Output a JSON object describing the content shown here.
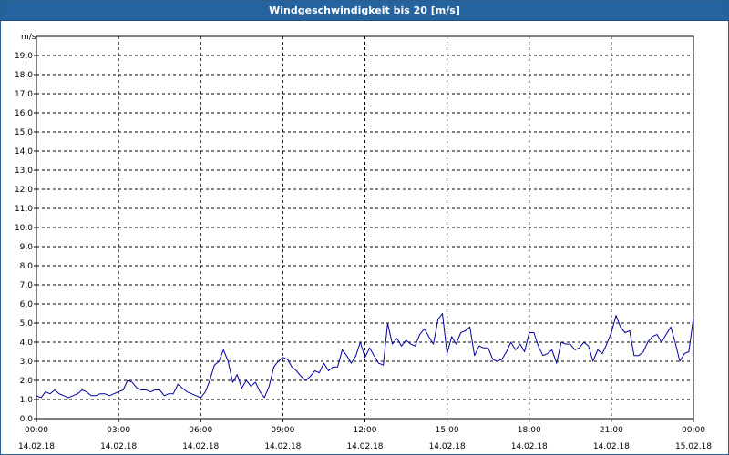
{
  "window": {
    "title": "Windgeschwindigkeit bis 20 [m/s]"
  },
  "colors": {
    "titlebar": "#2563a0",
    "series": "#0000a0",
    "grid": "#000000"
  },
  "chart_data": {
    "type": "line",
    "title": "Windgeschwindigkeit bis 20 [m/s]",
    "ylabel": "m/s",
    "ylim": [
      0,
      20
    ],
    "xlim_hours": [
      0,
      24
    ],
    "grid": true,
    "y_ticks": [
      "0,0",
      "1,0",
      "2,0",
      "3,0",
      "4,0",
      "5,0",
      "6,0",
      "7,0",
      "8,0",
      "9,0",
      "10,0",
      "11,0",
      "12,0",
      "13,0",
      "14,0",
      "15,0",
      "16,0",
      "17,0",
      "18,0",
      "19,0"
    ],
    "x_ticks": [
      {
        "time": "00:00",
        "date": "14.02.18"
      },
      {
        "time": "03:00",
        "date": "14.02.18"
      },
      {
        "time": "06:00",
        "date": "14.02.18"
      },
      {
        "time": "09:00",
        "date": "14.02.18"
      },
      {
        "time": "12:00",
        "date": "14.02.18"
      },
      {
        "time": "15:00",
        "date": "14.02.18"
      },
      {
        "time": "18:00",
        "date": "14.02.18"
      },
      {
        "time": "21:00",
        "date": "14.02.18"
      },
      {
        "time": "00:00",
        "date": "15.02.18"
      }
    ],
    "series": [
      {
        "x_hours": [
          0,
          0.17,
          0.33,
          0.5,
          0.67,
          0.83,
          1,
          1.17,
          1.33,
          1.5,
          1.67,
          1.83,
          2,
          2.17,
          2.33,
          2.5,
          2.67,
          2.83,
          3,
          3.17,
          3.33,
          3.5,
          3.67,
          3.83,
          4,
          4.17,
          4.33,
          4.5,
          4.67,
          4.83,
          5,
          5.17,
          5.33,
          5.5,
          5.67,
          5.83,
          6,
          6.17,
          6.33,
          6.5,
          6.67,
          6.83,
          7,
          7.17,
          7.33,
          7.5,
          7.67,
          7.83,
          8,
          8.17,
          8.33,
          8.5,
          8.67,
          8.83,
          9,
          9.17,
          9.33,
          9.5,
          9.67,
          9.83,
          10,
          10.17,
          10.33,
          10.5,
          10.67,
          10.83,
          11,
          11.17,
          11.33,
          11.5,
          11.67,
          11.83,
          12,
          12.17,
          12.33,
          12.5,
          12.67,
          12.83,
          13,
          13.17,
          13.33,
          13.5,
          13.67,
          13.83,
          14,
          14.17,
          14.33,
          14.5,
          14.67,
          14.83,
          15,
          15.17,
          15.33,
          15.5,
          15.67,
          15.83,
          16,
          16.17,
          16.33,
          16.5,
          16.67,
          16.83,
          17,
          17.17,
          17.33,
          17.5,
          17.67,
          17.83,
          18,
          18.17,
          18.33,
          18.5,
          18.67,
          18.83,
          19,
          19.17,
          19.33,
          19.5,
          19.67,
          19.83,
          20,
          20.17,
          20.33,
          20.5,
          20.67,
          20.83,
          21,
          21.17,
          21.33,
          21.5,
          21.67,
          21.83,
          22,
          22.17,
          22.33,
          22.5,
          22.67,
          22.83,
          23,
          23.17,
          23.33,
          23.5,
          23.67,
          23.83,
          24
        ],
        "values": [
          1.2,
          1.1,
          1.4,
          1.3,
          1.5,
          1.3,
          1.2,
          1.1,
          1.2,
          1.3,
          1.5,
          1.4,
          1.2,
          1.2,
          1.3,
          1.3,
          1.2,
          1.3,
          1.4,
          1.5,
          2.0,
          1.9,
          1.6,
          1.5,
          1.5,
          1.4,
          1.5,
          1.5,
          1.2,
          1.3,
          1.3,
          1.8,
          1.6,
          1.4,
          1.3,
          1.2,
          1.1,
          1.4,
          2.0,
          2.8,
          3.0,
          3.6,
          3.0,
          1.9,
          2.3,
          1.6,
          2.0,
          1.7,
          1.9,
          1.4,
          1.1,
          1.7,
          2.7,
          3.0,
          3.2,
          3.1,
          2.7,
          2.5,
          2.2,
          2.0,
          2.2,
          2.5,
          2.4,
          2.9,
          2.5,
          2.7,
          2.7,
          3.6,
          3.3,
          2.9,
          3.3,
          4.0,
          3.2,
          3.7,
          3.3,
          2.9,
          2.8,
          5.0,
          3.9,
          4.2,
          3.8,
          4.1,
          3.9,
          3.8,
          4.4,
          4.7,
          4.3,
          3.9,
          5.2,
          5.5,
          3.4,
          4.3,
          3.9,
          4.5,
          4.6,
          4.8,
          3.3,
          3.8,
          3.7,
          3.7,
          3.1,
          3.0,
          3.1,
          3.5,
          4.0,
          3.6,
          3.9,
          3.5,
          4.5,
          4.5,
          3.8,
          3.3,
          3.4,
          3.6,
          2.9,
          4.0,
          3.9,
          3.9,
          3.6,
          3.7,
          4.0,
          3.8,
          3.0,
          3.6,
          3.4,
          3.9,
          4.5,
          5.4,
          4.8,
          4.5,
          4.6,
          3.3,
          3.3,
          3.5,
          4.0,
          4.3,
          4.4,
          4.0,
          4.4,
          4.8,
          4.0,
          3.0,
          3.4,
          3.5,
          5.3,
          4.8
        ]
      }
    ]
  }
}
